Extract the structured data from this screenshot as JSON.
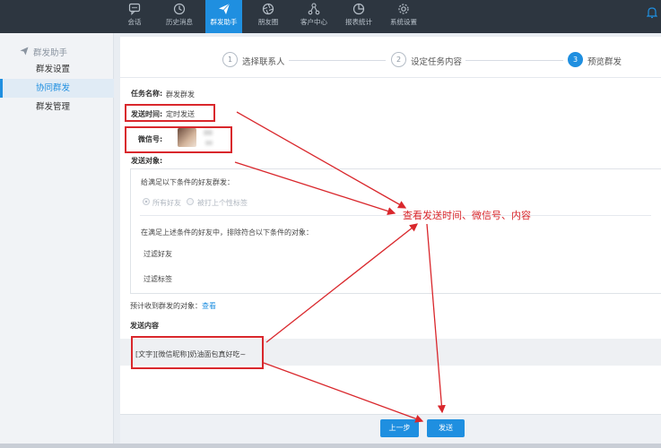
{
  "nav": {
    "items": [
      {
        "label": "会话",
        "icon": "chat-icon"
      },
      {
        "label": "历史消息",
        "icon": "clock-icon"
      },
      {
        "label": "群发助手",
        "icon": "send-icon",
        "active": true
      },
      {
        "label": "朋友圈",
        "icon": "aperture-icon"
      },
      {
        "label": "客户中心",
        "icon": "network-icon"
      },
      {
        "label": "报表统计",
        "icon": "pie-chart-icon"
      },
      {
        "label": "系统设置",
        "icon": "gear-icon"
      }
    ]
  },
  "sidebar": {
    "header": "群发助手",
    "items": [
      {
        "label": "群发设置"
      },
      {
        "label": "协同群发",
        "active": true
      },
      {
        "label": "群发管理"
      }
    ]
  },
  "steps": [
    {
      "num": "1",
      "label": "选择联系人"
    },
    {
      "num": "2",
      "label": "设定任务内容"
    },
    {
      "num": "3",
      "label": "预览群发",
      "active": true
    }
  ],
  "form": {
    "task_name_label": "任务名称:",
    "task_name_value": "群发群发",
    "send_time_label": "发送时间:",
    "send_time_value": "定时发送",
    "wechat_label": "微信号:",
    "target_label": "发送对象:",
    "cond_title": "给满足以下条件的好友群发：",
    "opt_all": "所有好友",
    "opt_tags": "被打上个性标签",
    "exclude_title": "在满足上述条件的好友中，排除符合以下条件的对象：",
    "filter_friends": "过滤好友",
    "filter_tags": "过滤标签",
    "estimate_prefix": "预计收到群发的对象：",
    "estimate_link": "查看",
    "content_label": "发送内容",
    "content_value": "[文字][微信昵称]奶油面包真好吃~"
  },
  "buttons": {
    "prev": "上一步",
    "send": "发送"
  },
  "annotation": "查看发送时间、微信号、内容",
  "colors": {
    "accent": "#1f8fe0",
    "nav_bg": "#2d3640",
    "annotation": "#d9272c"
  }
}
